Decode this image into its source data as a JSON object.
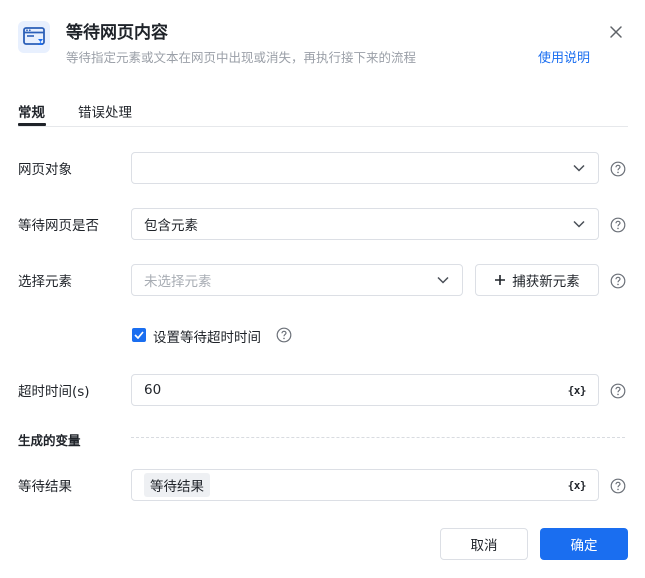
{
  "header": {
    "title": "等待网页内容",
    "subtitle": "等待指定元素或文本在网页中出现或消失，再执行接下来的流程",
    "help_link": "使用说明",
    "icon": "browser-window-icon"
  },
  "tabs": [
    {
      "label": "常规",
      "active": true
    },
    {
      "label": "错误处理",
      "active": false
    }
  ],
  "form": {
    "web_object": {
      "label": "网页对象",
      "value": ""
    },
    "wait_condition": {
      "label": "等待网页是否",
      "value": "包含元素"
    },
    "select_element": {
      "label": "选择元素",
      "placeholder": "未选择元素",
      "capture_button": "捕获新元素"
    },
    "timeout_checkbox": {
      "label": "设置等待超时时间",
      "checked": true
    },
    "timeout": {
      "label": "超时时间(s)",
      "value": "60",
      "var_icon": "{x}"
    },
    "generated_vars": {
      "title": "生成的变量"
    },
    "wait_result": {
      "label": "等待结果",
      "tag": "等待结果",
      "var_icon": "{x}"
    }
  },
  "footer": {
    "cancel_label": "取消",
    "ok_label": "确定"
  },
  "colors": {
    "primary": "#1a6ef0",
    "text": "#1f2329",
    "muted": "#9ba0a8",
    "border": "#dcdfe5"
  }
}
